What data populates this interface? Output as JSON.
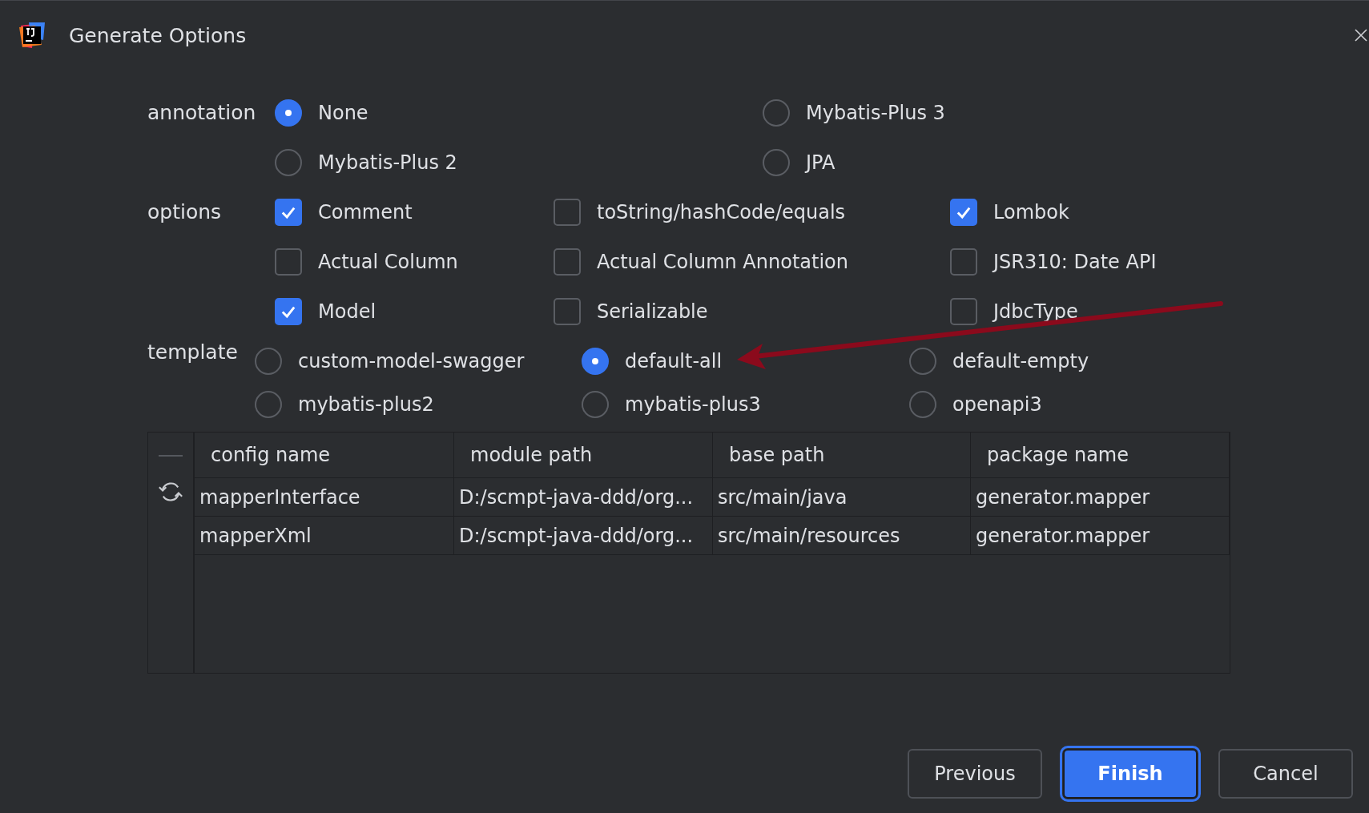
{
  "window": {
    "title": "Generate Options"
  },
  "annotation": {
    "label": "annotation",
    "options": [
      {
        "label": "None",
        "selected": true
      },
      {
        "label": "Mybatis-Plus 3",
        "selected": false
      },
      {
        "label": "Mybatis-Plus 2",
        "selected": false
      },
      {
        "label": "JPA",
        "selected": false
      }
    ]
  },
  "options": {
    "label": "options",
    "items": [
      {
        "label": "Comment",
        "checked": true
      },
      {
        "label": "toString/hashCode/equals",
        "checked": false
      },
      {
        "label": "Lombok",
        "checked": true
      },
      {
        "label": "Actual Column",
        "checked": false
      },
      {
        "label": "Actual Column Annotation",
        "checked": false
      },
      {
        "label": "JSR310: Date API",
        "checked": false
      },
      {
        "label": "Model",
        "checked": true
      },
      {
        "label": "Serializable",
        "checked": false
      },
      {
        "label": "JdbcType",
        "checked": false
      }
    ]
  },
  "template": {
    "label": "template",
    "options": [
      {
        "label": "custom-model-swagger",
        "selected": false
      },
      {
        "label": "default-all",
        "selected": true
      },
      {
        "label": "default-empty",
        "selected": false
      },
      {
        "label": "mybatis-plus2",
        "selected": false
      },
      {
        "label": "mybatis-plus3",
        "selected": false
      },
      {
        "label": "openapi3",
        "selected": false
      }
    ]
  },
  "table": {
    "columns": [
      "config name",
      "module path",
      "base path",
      "package name"
    ],
    "rows": [
      [
        "mapperInterface",
        "D:/scmpt-java-ddd/org...",
        "src/main/java",
        "generator.mapper"
      ],
      [
        "mapperXml",
        "D:/scmpt-java-ddd/org...",
        "src/main/resources",
        "generator.mapper"
      ]
    ]
  },
  "buttons": [
    {
      "label": "Previous",
      "kind": "default"
    },
    {
      "label": "Finish",
      "kind": "primary"
    },
    {
      "label": "Cancel",
      "kind": "default"
    }
  ]
}
